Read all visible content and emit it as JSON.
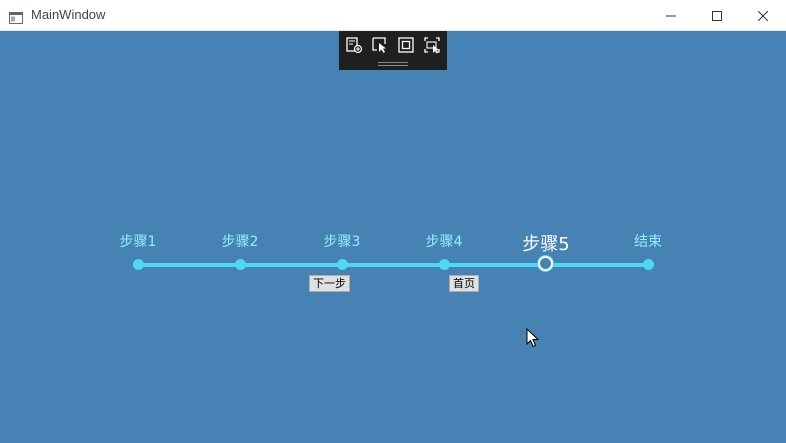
{
  "window": {
    "title": "MainWindow",
    "controls": [
      "minimize-icon",
      "maximize-icon",
      "close-icon"
    ]
  },
  "debug_toolbar": {
    "icons": [
      "live-visual-tree-icon",
      "select-element-icon",
      "display-layout-adorners-icon",
      "track-focus-icon"
    ]
  },
  "stepper": {
    "current_index": 4,
    "steps": [
      {
        "label": "步骤1"
      },
      {
        "label": "步骤2"
      },
      {
        "label": "步骤3"
      },
      {
        "label": "步骤4"
      },
      {
        "label": "步骤5"
      },
      {
        "label": "结束"
      }
    ]
  },
  "buttons": {
    "next_label": "下一步",
    "home_label": "首页"
  },
  "colors": {
    "background": "#4682b4",
    "track": "#4dd9f0",
    "label": "#8ff0ff",
    "current_label": "#ffffff"
  }
}
